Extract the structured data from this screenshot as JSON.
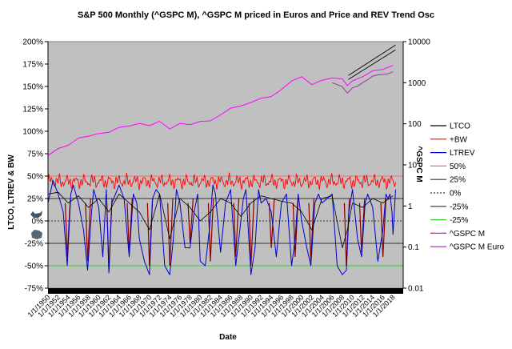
{
  "chart_data": {
    "type": "line",
    "title": "S&P 500 Monthly (^GSPC M), ^GSPC M priced in Euros and Price and REV Trend Osc",
    "xlabel": "Date",
    "ylabel_left": "LTCO, LTREV & BW",
    "ylabel_right": "^GSPC M",
    "x_range": [
      1950,
      2020
    ],
    "ylim_left": [
      -75,
      200
    ],
    "ylim_right_log": [
      0.01,
      10000
    ],
    "grid": false,
    "legend_position": "right",
    "left_ticks": [
      {
        "v": -75,
        "label": "-75%"
      },
      {
        "v": -50,
        "label": "-50%"
      },
      {
        "v": -25,
        "label": "-25%"
      },
      {
        "v": 0,
        "label": "0%"
      },
      {
        "v": 25,
        "label": "25%"
      },
      {
        "v": 50,
        "label": "50%"
      },
      {
        "v": 75,
        "label": "75%"
      },
      {
        "v": 100,
        "label": "100%"
      },
      {
        "v": 125,
        "label": "125%"
      },
      {
        "v": 150,
        "label": "150%"
      },
      {
        "v": 175,
        "label": "175%"
      },
      {
        "v": 200,
        "label": "200%"
      }
    ],
    "right_ticks": [
      {
        "v": 0.01,
        "label": "0.01"
      },
      {
        "v": 0.1,
        "label": "0.1"
      },
      {
        "v": 1,
        "label": "1"
      },
      {
        "v": 10,
        "label": "10"
      },
      {
        "v": 100,
        "label": "100"
      },
      {
        "v": 1000,
        "label": "1000"
      },
      {
        "v": 10000,
        "label": "10000"
      }
    ],
    "x_tick_labels": [
      "1/1/1950",
      "1/1/1952",
      "1/1/1954",
      "1/1/1956",
      "1/1/1958",
      "1/1/1960",
      "1/1/1962",
      "1/1/1964",
      "1/1/1966",
      "1/1/1968",
      "1/1/1970",
      "1/1/1972",
      "1/1/1974",
      "1/1/1976",
      "1/1/1978",
      "1/1/1980",
      "1/1/1982",
      "1/1/1984",
      "1/1/1986",
      "1/1/1988",
      "1/1/1990",
      "1/1/1992",
      "1/1/1994",
      "1/1/1996",
      "1/1/1998",
      "1/1/2000",
      "1/1/2002",
      "1/1/2004",
      "1/1/2006",
      "1/1/2008",
      "1/1/2010",
      "1/1/2012",
      "1/1/2014",
      "1/1/2016",
      "1/1/2018"
    ],
    "reference_lines": [
      {
        "name": "50%",
        "value": 50,
        "color": "#ff6666",
        "dash": false
      },
      {
        "name": "25%",
        "value": 25,
        "color": "#333333",
        "dash": false
      },
      {
        "name": "0%",
        "value": 0,
        "color": "#333333",
        "dash": true
      },
      {
        "name": "-25%",
        "value": -25,
        "color": "#333333",
        "dash": false
      },
      {
        "name": "-25%",
        "value": -50,
        "color": "#33cc33",
        "dash": false
      }
    ],
    "legend": [
      {
        "name": "LTCO",
        "color": "#000000",
        "dash": false
      },
      {
        "name": "+BW",
        "color": "#ff0000",
        "dash": false
      },
      {
        "name": "LTREV",
        "color": "#0000cc",
        "dash": false
      },
      {
        "name": "50%",
        "color": "#ff6666",
        "dash": false
      },
      {
        "name": "25%",
        "color": "#333333",
        "dash": false
      },
      {
        "name": "0%",
        "color": "#333333",
        "dash": true
      },
      {
        "name": "-25%",
        "color": "#333333",
        "dash": false
      },
      {
        "name": "-25%",
        "color": "#33cc33",
        "dash": false
      },
      {
        "name": "^GSPC M",
        "color": "#ff00ff",
        "dash": false
      },
      {
        "name": "^GSPC M Euro",
        "color": "#993399",
        "dash": false
      }
    ],
    "gspc": {
      "color": "#ff00ff",
      "x": [
        1950,
        1952,
        1954,
        1956,
        1958,
        1960,
        1962,
        1964,
        1966,
        1968,
        1970,
        1972,
        1974,
        1976,
        1978,
        1980,
        1982,
        1984,
        1986,
        1988,
        1990,
        1992,
        1994,
        1996,
        1998,
        2000,
        2002,
        2004,
        2006,
        2008,
        2009,
        2010,
        2012,
        2014,
        2016,
        2018
      ],
      "y": [
        17,
        25,
        30,
        45,
        50,
        58,
        62,
        82,
        88,
        102,
        90,
        115,
        75,
        102,
        95,
        115,
        118,
        165,
        240,
        270,
        330,
        420,
        460,
        680,
        1100,
        1400,
        900,
        1150,
        1300,
        1250,
        850,
        1110,
        1400,
        1950,
        2100,
        2650
      ]
    },
    "gspc_euro": {
      "color": "#993399",
      "x": [
        2006,
        2007,
        2008,
        2009,
        2010,
        2011,
        2012,
        2013,
        2014,
        2015,
        2016,
        2017,
        2018
      ],
      "y": [
        1000,
        900,
        800,
        560,
        750,
        820,
        1000,
        1180,
        1450,
        1550,
        1600,
        1650,
        1850
      ]
    },
    "trend_channels": [
      {
        "x": [
          2009.2,
          2018.5
        ],
        "y": [
          1200,
          6300
        ],
        "color": "#000000"
      },
      {
        "x": [
          2009.2,
          2018.5
        ],
        "y": [
          1500,
          8300
        ],
        "color": "#000000"
      }
    ],
    "bw_plus": {
      "color": "#ff0000",
      "base": 50,
      "amplitude": 6
    },
    "ltrev": {
      "color": "#0000cc",
      "x": [
        1950,
        1951,
        1952,
        1953,
        1953.8,
        1954.5,
        1955,
        1956,
        1957,
        1957.8,
        1958.6,
        1959,
        1960,
        1960.8,
        1961.5,
        1962,
        1962.6,
        1963.3,
        1964,
        1965,
        1966,
        1966.8,
        1967.5,
        1968,
        1969,
        1970,
        1970.6,
        1971.3,
        1972,
        1973,
        1974,
        1974.7,
        1975.3,
        1976,
        1977,
        1978,
        1978.8,
        1979.5,
        1980,
        1981,
        1981.8,
        1982.5,
        1983,
        1984,
        1985,
        1986,
        1987,
        1987.8,
        1988.5,
        1989,
        1990,
        1990.8,
        1991.5,
        1992,
        1993,
        1994,
        1995,
        1996,
        1997,
        1998,
        1998.7,
        1999.3,
        2000,
        2001,
        2001.8,
        2002.6,
        2003.3,
        2004,
        2005,
        2006,
        2007,
        2008,
        2008.8,
        2009.3,
        2010,
        2011,
        2011.8,
        2012.5,
        2013,
        2014,
        2015,
        2016,
        2016.6,
        2017,
        2017.4,
        2017.8,
        2018,
        2018.5
      ],
      "y": [
        20,
        45,
        30,
        10,
        -50,
        30,
        40,
        20,
        -10,
        -55,
        10,
        35,
        15,
        -40,
        35,
        -58,
        20,
        30,
        40,
        25,
        -40,
        30,
        20,
        -20,
        -45,
        -60,
        25,
        35,
        30,
        -50,
        -60,
        -20,
        35,
        20,
        -30,
        -30,
        10,
        30,
        -45,
        -50,
        -10,
        40,
        30,
        -35,
        20,
        35,
        -50,
        -10,
        25,
        35,
        -60,
        -30,
        35,
        20,
        25,
        10,
        -40,
        20,
        30,
        -50,
        -20,
        30,
        0,
        -30,
        -50,
        20,
        30,
        20,
        25,
        30,
        -50,
        -60,
        -55,
        10,
        35,
        -20,
        -40,
        20,
        30,
        15,
        -45,
        -10,
        30,
        25,
        30,
        10,
        -15,
        35
      ]
    },
    "ltco": {
      "color": "#000000",
      "x": [
        1950,
        1952,
        1954,
        1956,
        1958,
        1960,
        1962,
        1964,
        1966,
        1968,
        1970,
        1972,
        1974,
        1976,
        1978,
        1980,
        1982,
        1984,
        1986,
        1988,
        1990,
        1992,
        1994,
        1996,
        1998,
        2000,
        2002,
        2004,
        2006,
        2008,
        2009,
        2010,
        2012,
        2014,
        2016,
        2018
      ],
      "y": [
        30,
        32,
        20,
        28,
        15,
        25,
        10,
        30,
        20,
        10,
        -10,
        30,
        -20,
        25,
        15,
        0,
        10,
        25,
        20,
        5,
        20,
        28,
        25,
        22,
        20,
        10,
        -10,
        25,
        28,
        -30,
        -10,
        20,
        15,
        25,
        20,
        28
      ]
    },
    "ltco_dark_dips": {
      "color": "#880000",
      "x": [
        1953.8,
        1957.8,
        1962,
        1966,
        1970,
        1974,
        1978,
        1982,
        1987,
        1990,
        1994,
        1998.7,
        2001.8,
        2008.8,
        2011.8,
        2016
      ],
      "y": [
        -40,
        -45,
        -55,
        -35,
        -50,
        -50,
        -25,
        -45,
        -40,
        -50,
        -30,
        -40,
        -45,
        -50,
        -35,
        -40
      ]
    }
  }
}
